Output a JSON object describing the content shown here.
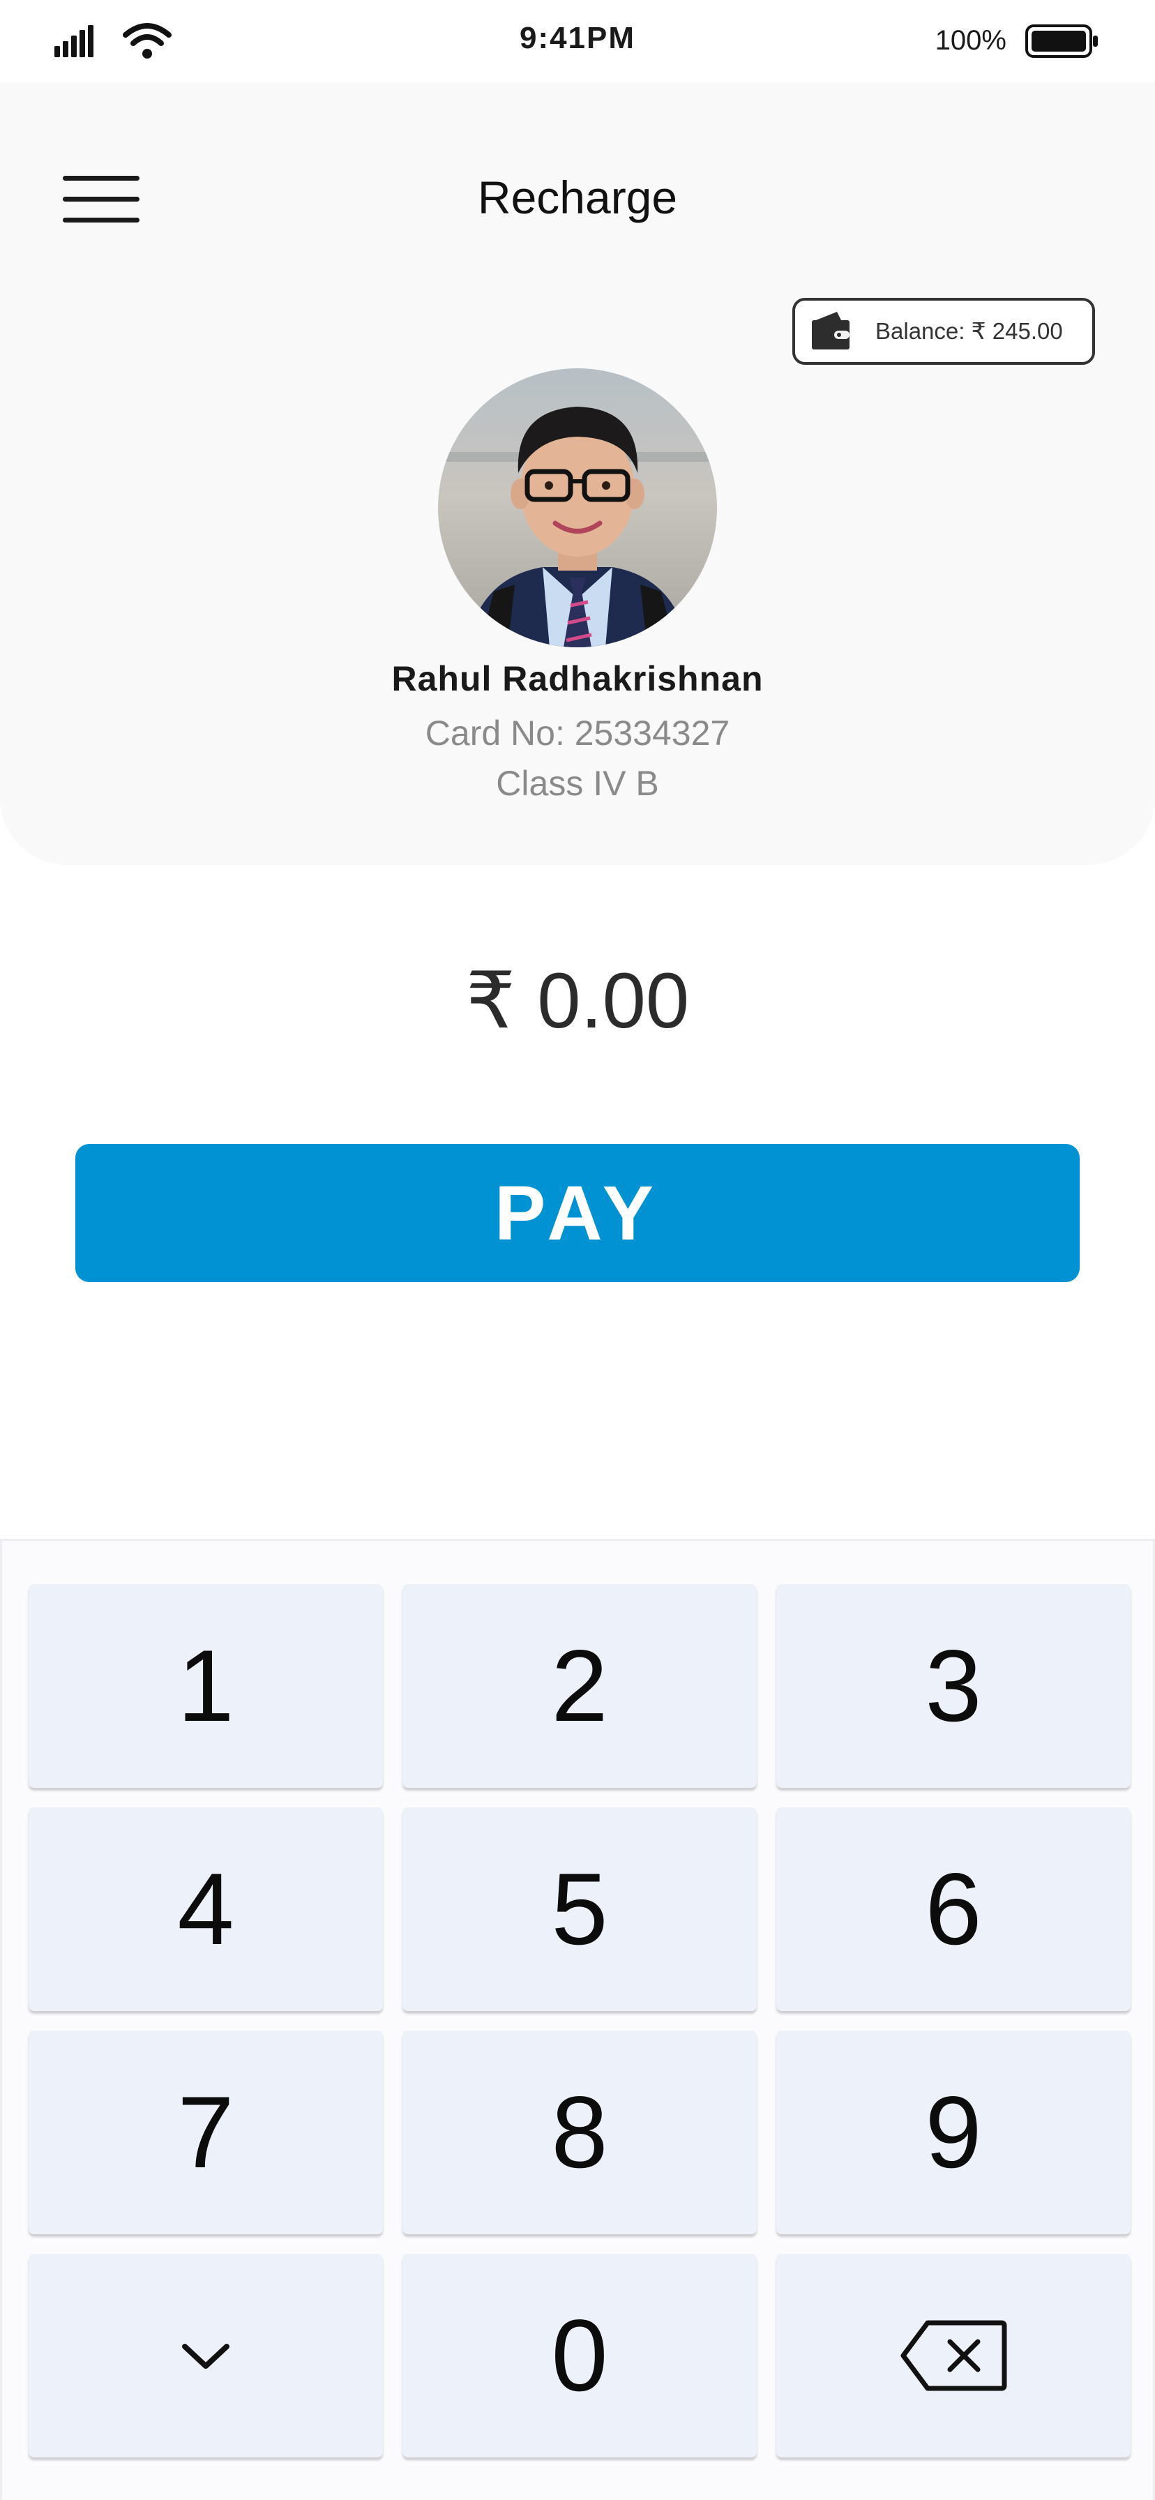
{
  "status_bar": {
    "time": "9:41PM",
    "battery_percent": "100%",
    "icons": [
      "signal-icon",
      "wifi-icon",
      "battery-icon"
    ]
  },
  "header": {
    "title": "Recharge",
    "menu_icon": "hamburger-menu-icon"
  },
  "balance": {
    "icon": "wallet-icon",
    "label": "Balance: ₹ 245.00"
  },
  "student": {
    "name": "Rahul Radhakrishnan",
    "card_no": "Card No: 25334327",
    "class_name": "Class IV B"
  },
  "amount": {
    "display": "₹ 0.00"
  },
  "pay_button": {
    "label": "PAY",
    "color": "#0092d3"
  },
  "keypad": {
    "keys": [
      "1",
      "2",
      "3",
      "4",
      "5",
      "6",
      "7",
      "8",
      "9",
      "",
      "0",
      ""
    ],
    "collapse_icon": "chevron-down-icon",
    "backspace_icon": "backspace-icon",
    "key_color": "#edf1f9"
  }
}
